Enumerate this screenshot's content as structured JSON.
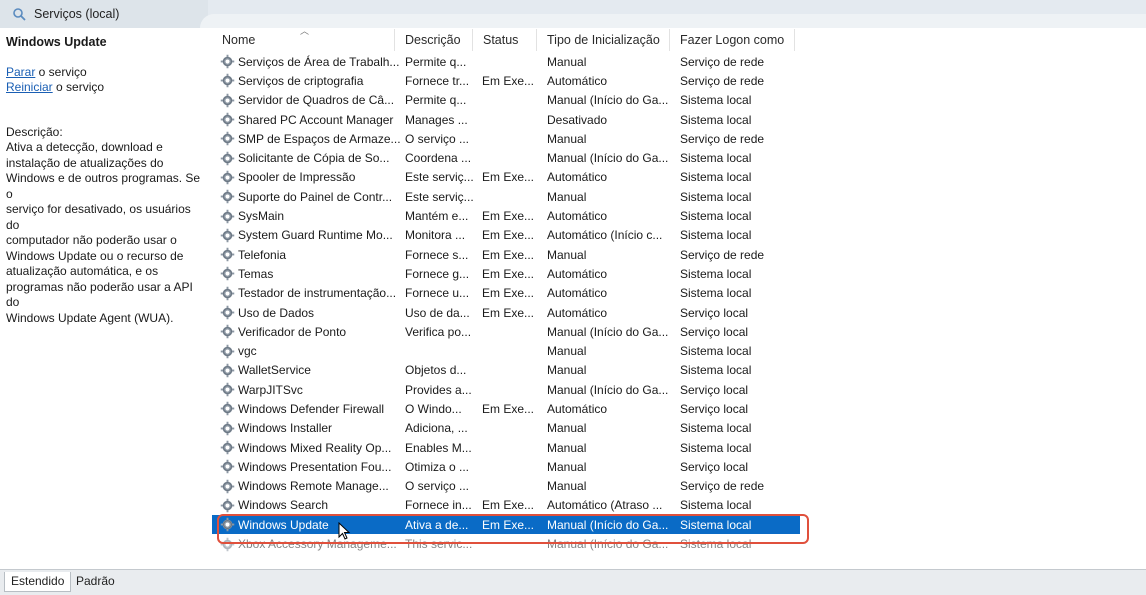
{
  "window": {
    "title": "Serviços (local)"
  },
  "left_pane": {
    "service_name": "Windows Update",
    "stop_link": "Parar",
    "stop_suffix": " o serviço",
    "restart_link": "Reiniciar",
    "restart_suffix": " o serviço",
    "description_label": "Descrição:",
    "description_lines": [
      "Ativa a detecção, download e",
      "instalação de atualizações do",
      "Windows e de outros programas. Se o",
      "serviço for desativado, os usuários do",
      "computador não poderão usar o",
      "Windows Update ou o recurso de",
      "atualização automática, e os",
      "programas não poderão usar a API do",
      "Windows Update Agent (WUA)."
    ]
  },
  "columns": {
    "name": "Nome",
    "description": "Descrição",
    "status": "Status",
    "startup": "Tipo de Inicialização",
    "logon": "Fazer Logon como"
  },
  "rows": [
    {
      "name": "Serviços de Área de Trabalh...",
      "description": "Permite q...",
      "status": "",
      "startup": "Manual",
      "logon": "Serviço de rede"
    },
    {
      "name": "Serviços de criptografia",
      "description": "Fornece tr...",
      "status": "Em Exe...",
      "startup": "Automático",
      "logon": "Serviço de rede"
    },
    {
      "name": "Servidor de Quadros de Câ...",
      "description": "Permite q...",
      "status": "",
      "startup": "Manual (Início do Ga...",
      "logon": "Sistema local"
    },
    {
      "name": "Shared PC Account Manager",
      "description": "Manages ...",
      "status": "",
      "startup": "Desativado",
      "logon": "Sistema local"
    },
    {
      "name": "SMP de Espaços de Armaze...",
      "description": "O serviço ...",
      "status": "",
      "startup": "Manual",
      "logon": "Serviço de rede"
    },
    {
      "name": "Solicitante de Cópia de So...",
      "description": "Coordena ...",
      "status": "",
      "startup": "Manual (Início do Ga...",
      "logon": "Sistema local"
    },
    {
      "name": "Spooler de Impressão",
      "description": "Este serviç...",
      "status": "Em Exe...",
      "startup": "Automático",
      "logon": "Sistema local"
    },
    {
      "name": "Suporte do Painel de Contr...",
      "description": "Este serviç...",
      "status": "",
      "startup": "Manual",
      "logon": "Sistema local"
    },
    {
      "name": "SysMain",
      "description": "Mantém e...",
      "status": "Em Exe...",
      "startup": "Automático",
      "logon": "Sistema local"
    },
    {
      "name": "System Guard Runtime Mo...",
      "description": "Monitora ...",
      "status": "Em Exe...",
      "startup": "Automático (Início c...",
      "logon": "Sistema local"
    },
    {
      "name": "Telefonia",
      "description": "Fornece s...",
      "status": "Em Exe...",
      "startup": "Manual",
      "logon": "Serviço de rede"
    },
    {
      "name": "Temas",
      "description": "Fornece g...",
      "status": "Em Exe...",
      "startup": "Automático",
      "logon": "Sistema local"
    },
    {
      "name": "Testador de instrumentação...",
      "description": "Fornece u...",
      "status": "Em Exe...",
      "startup": "Automático",
      "logon": "Sistema local"
    },
    {
      "name": "Uso de Dados",
      "description": "Uso de da...",
      "status": "Em Exe...",
      "startup": "Automático",
      "logon": "Serviço local"
    },
    {
      "name": "Verificador de Ponto",
      "description": "Verifica po...",
      "status": "",
      "startup": "Manual (Início do Ga...",
      "logon": "Serviço local"
    },
    {
      "name": "vgc",
      "description": "",
      "status": "",
      "startup": "Manual",
      "logon": "Sistema local"
    },
    {
      "name": "WalletService",
      "description": "Objetos d...",
      "status": "",
      "startup": "Manual",
      "logon": "Sistema local"
    },
    {
      "name": "WarpJITSvc",
      "description": "Provides a...",
      "status": "",
      "startup": "Manual (Início do Ga...",
      "logon": "Serviço local"
    },
    {
      "name": "Windows Defender Firewall",
      "description": "O Windo...",
      "status": "Em Exe...",
      "startup": "Automático",
      "logon": "Serviço local"
    },
    {
      "name": "Windows Installer",
      "description": "Adiciona, ...",
      "status": "",
      "startup": "Manual",
      "logon": "Sistema local"
    },
    {
      "name": "Windows Mixed Reality Op...",
      "description": "Enables M...",
      "status": "",
      "startup": "Manual",
      "logon": "Sistema local"
    },
    {
      "name": "Windows Presentation Fou...",
      "description": "Otimiza o ...",
      "status": "",
      "startup": "Manual",
      "logon": "Serviço local"
    },
    {
      "name": "Windows Remote Manage...",
      "description": "O serviço ...",
      "status": "",
      "startup": "Manual",
      "logon": "Serviço de rede"
    },
    {
      "name": "Windows Search",
      "description": "Fornece in...",
      "status": "Em Exe...",
      "startup": "Automático (Atraso ...",
      "logon": "Sistema local"
    },
    {
      "name": "Windows Update",
      "description": "Ativa a de...",
      "status": "Em Exe...",
      "startup": "Manual (Início do Ga...",
      "logon": "Sistema local",
      "selected": true
    },
    {
      "name": "Xbox Accessory Manageme...",
      "description": "This servic...",
      "status": "",
      "startup": "Manual (Início do Ga...",
      "logon": "Sistema local"
    }
  ],
  "bottom_tabs": [
    "Estendido",
    "Padrão"
  ],
  "colors": {
    "selection": "#0a6bc6",
    "highlight_box": "#e0503c",
    "link": "#1a5fb4"
  }
}
